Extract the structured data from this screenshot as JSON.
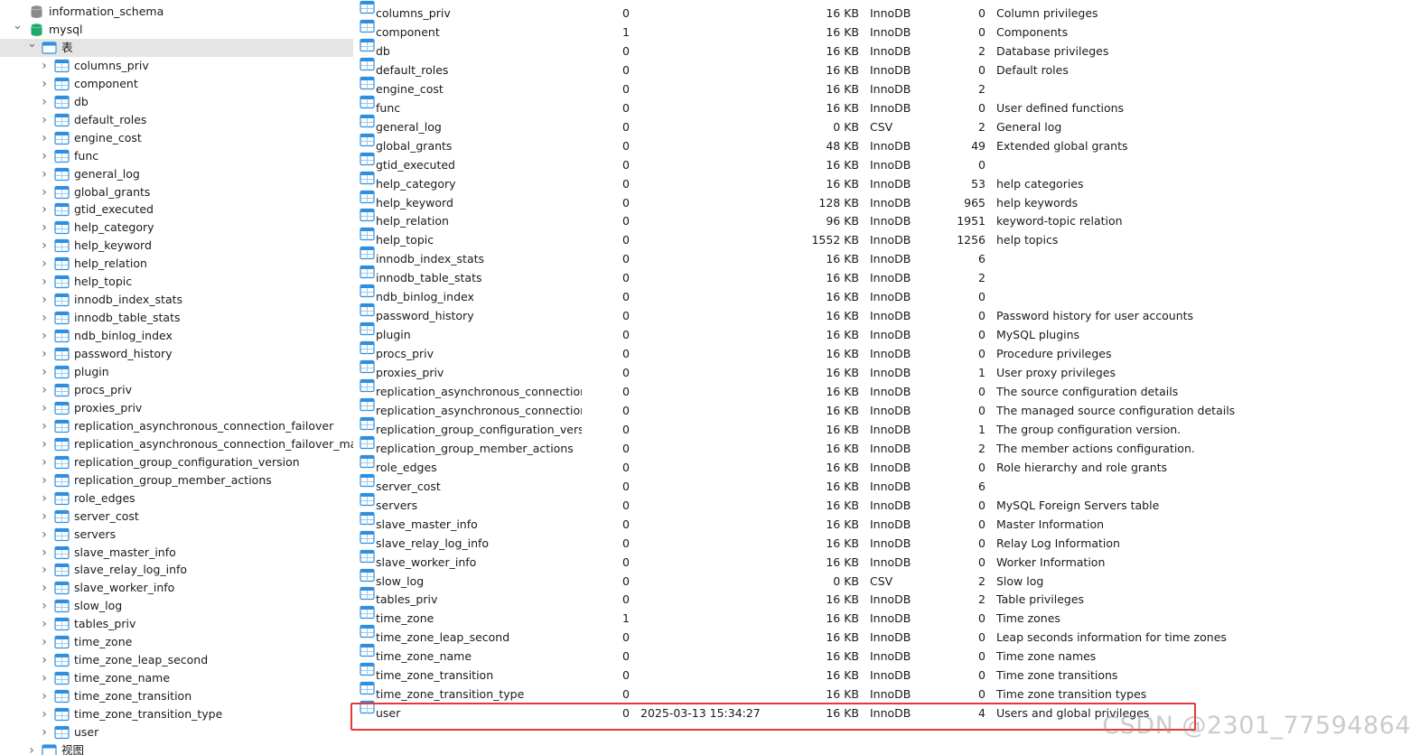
{
  "tree": {
    "databases": [
      {
        "label": "information_schema",
        "expanded": false,
        "icon": "database-icon-gray"
      },
      {
        "label": "mysql",
        "expanded": true,
        "icon": "database-icon-green"
      }
    ],
    "tables_folder": {
      "label": "表",
      "expanded": true
    },
    "tables": [
      "columns_priv",
      "component",
      "db",
      "default_roles",
      "engine_cost",
      "func",
      "general_log",
      "global_grants",
      "gtid_executed",
      "help_category",
      "help_keyword",
      "help_relation",
      "help_topic",
      "innodb_index_stats",
      "innodb_table_stats",
      "ndb_binlog_index",
      "password_history",
      "plugin",
      "procs_priv",
      "proxies_priv",
      "replication_asynchronous_connection_failover",
      "replication_asynchronous_connection_failover_managed",
      "replication_group_configuration_version",
      "replication_group_member_actions",
      "role_edges",
      "server_cost",
      "servers",
      "slave_master_info",
      "slave_relay_log_info",
      "slave_worker_info",
      "slow_log",
      "tables_priv",
      "time_zone",
      "time_zone_leap_second",
      "time_zone_name",
      "time_zone_transition",
      "time_zone_transition_type",
      "user"
    ],
    "views_folder": {
      "label": "视图",
      "expanded": false
    }
  },
  "list": {
    "rows": [
      {
        "name": "columns_priv",
        "rows": "0",
        "modified": "",
        "size": "16 KB",
        "engine": "InnoDB",
        "auto": "0",
        "comment": "Column privileges"
      },
      {
        "name": "component",
        "rows": "1",
        "modified": "",
        "size": "16 KB",
        "engine": "InnoDB",
        "auto": "0",
        "comment": "Components"
      },
      {
        "name": "db",
        "rows": "0",
        "modified": "",
        "size": "16 KB",
        "engine": "InnoDB",
        "auto": "2",
        "comment": "Database privileges"
      },
      {
        "name": "default_roles",
        "rows": "0",
        "modified": "",
        "size": "16 KB",
        "engine": "InnoDB",
        "auto": "0",
        "comment": "Default roles"
      },
      {
        "name": "engine_cost",
        "rows": "0",
        "modified": "",
        "size": "16 KB",
        "engine": "InnoDB",
        "auto": "2",
        "comment": ""
      },
      {
        "name": "func",
        "rows": "0",
        "modified": "",
        "size": "16 KB",
        "engine": "InnoDB",
        "auto": "0",
        "comment": "User defined functions"
      },
      {
        "name": "general_log",
        "rows": "0",
        "modified": "",
        "size": "0 KB",
        "engine": "CSV",
        "auto": "2",
        "comment": "General log"
      },
      {
        "name": "global_grants",
        "rows": "0",
        "modified": "",
        "size": "48 KB",
        "engine": "InnoDB",
        "auto": "49",
        "comment": "Extended global grants"
      },
      {
        "name": "gtid_executed",
        "rows": "0",
        "modified": "",
        "size": "16 KB",
        "engine": "InnoDB",
        "auto": "0",
        "comment": ""
      },
      {
        "name": "help_category",
        "rows": "0",
        "modified": "",
        "size": "16 KB",
        "engine": "InnoDB",
        "auto": "53",
        "comment": "help categories"
      },
      {
        "name": "help_keyword",
        "rows": "0",
        "modified": "",
        "size": "128 KB",
        "engine": "InnoDB",
        "auto": "965",
        "comment": "help keywords"
      },
      {
        "name": "help_relation",
        "rows": "0",
        "modified": "",
        "size": "96 KB",
        "engine": "InnoDB",
        "auto": "1951",
        "comment": "keyword-topic relation"
      },
      {
        "name": "help_topic",
        "rows": "0",
        "modified": "",
        "size": "1552 KB",
        "engine": "InnoDB",
        "auto": "1256",
        "comment": "help topics"
      },
      {
        "name": "innodb_index_stats",
        "rows": "0",
        "modified": "",
        "size": "16 KB",
        "engine": "InnoDB",
        "auto": "6",
        "comment": ""
      },
      {
        "name": "innodb_table_stats",
        "rows": "0",
        "modified": "",
        "size": "16 KB",
        "engine": "InnoDB",
        "auto": "2",
        "comment": ""
      },
      {
        "name": "ndb_binlog_index",
        "rows": "0",
        "modified": "",
        "size": "16 KB",
        "engine": "InnoDB",
        "auto": "0",
        "comment": ""
      },
      {
        "name": "password_history",
        "rows": "0",
        "modified": "",
        "size": "16 KB",
        "engine": "InnoDB",
        "auto": "0",
        "comment": "Password history for user accounts"
      },
      {
        "name": "plugin",
        "rows": "0",
        "modified": "",
        "size": "16 KB",
        "engine": "InnoDB",
        "auto": "0",
        "comment": "MySQL plugins"
      },
      {
        "name": "procs_priv",
        "rows": "0",
        "modified": "",
        "size": "16 KB",
        "engine": "InnoDB",
        "auto": "0",
        "comment": "Procedure privileges"
      },
      {
        "name": "proxies_priv",
        "rows": "0",
        "modified": "",
        "size": "16 KB",
        "engine": "InnoDB",
        "auto": "1",
        "comment": "User proxy privileges"
      },
      {
        "name": "replication_asynchronous_connection...",
        "rows": "0",
        "modified": "",
        "size": "16 KB",
        "engine": "InnoDB",
        "auto": "0",
        "comment": "The source configuration details"
      },
      {
        "name": "replication_asynchronous_connection...",
        "rows": "0",
        "modified": "",
        "size": "16 KB",
        "engine": "InnoDB",
        "auto": "0",
        "comment": "The managed source configuration details"
      },
      {
        "name": "replication_group_configuration_versi...",
        "rows": "0",
        "modified": "",
        "size": "16 KB",
        "engine": "InnoDB",
        "auto": "1",
        "comment": "The group configuration version."
      },
      {
        "name": "replication_group_member_actions",
        "rows": "0",
        "modified": "",
        "size": "16 KB",
        "engine": "InnoDB",
        "auto": "2",
        "comment": "The member actions configuration."
      },
      {
        "name": "role_edges",
        "rows": "0",
        "modified": "",
        "size": "16 KB",
        "engine": "InnoDB",
        "auto": "0",
        "comment": "Role hierarchy and role grants"
      },
      {
        "name": "server_cost",
        "rows": "0",
        "modified": "",
        "size": "16 KB",
        "engine": "InnoDB",
        "auto": "6",
        "comment": ""
      },
      {
        "name": "servers",
        "rows": "0",
        "modified": "",
        "size": "16 KB",
        "engine": "InnoDB",
        "auto": "0",
        "comment": "MySQL Foreign Servers table"
      },
      {
        "name": "slave_master_info",
        "rows": "0",
        "modified": "",
        "size": "16 KB",
        "engine": "InnoDB",
        "auto": "0",
        "comment": "Master Information"
      },
      {
        "name": "slave_relay_log_info",
        "rows": "0",
        "modified": "",
        "size": "16 KB",
        "engine": "InnoDB",
        "auto": "0",
        "comment": "Relay Log Information"
      },
      {
        "name": "slave_worker_info",
        "rows": "0",
        "modified": "",
        "size": "16 KB",
        "engine": "InnoDB",
        "auto": "0",
        "comment": "Worker Information"
      },
      {
        "name": "slow_log",
        "rows": "0",
        "modified": "",
        "size": "0 KB",
        "engine": "CSV",
        "auto": "2",
        "comment": "Slow log"
      },
      {
        "name": "tables_priv",
        "rows": "0",
        "modified": "",
        "size": "16 KB",
        "engine": "InnoDB",
        "auto": "2",
        "comment": "Table privileges"
      },
      {
        "name": "time_zone",
        "rows": "1",
        "modified": "",
        "size": "16 KB",
        "engine": "InnoDB",
        "auto": "0",
        "comment": "Time zones"
      },
      {
        "name": "time_zone_leap_second",
        "rows": "0",
        "modified": "",
        "size": "16 KB",
        "engine": "InnoDB",
        "auto": "0",
        "comment": "Leap seconds information for time zones"
      },
      {
        "name": "time_zone_name",
        "rows": "0",
        "modified": "",
        "size": "16 KB",
        "engine": "InnoDB",
        "auto": "0",
        "comment": "Time zone names"
      },
      {
        "name": "time_zone_transition",
        "rows": "0",
        "modified": "",
        "size": "16 KB",
        "engine": "InnoDB",
        "auto": "0",
        "comment": "Time zone transitions"
      },
      {
        "name": "time_zone_transition_type",
        "rows": "0",
        "modified": "",
        "size": "16 KB",
        "engine": "InnoDB",
        "auto": "0",
        "comment": "Time zone transition types"
      },
      {
        "name": "user",
        "rows": "0",
        "modified": "2025-03-13 15:34:27",
        "size": "16 KB",
        "engine": "InnoDB",
        "auto": "4",
        "comment": "Users and global privileges"
      }
    ],
    "highlighted_row": "user"
  },
  "colors": {
    "highlight_border": "#e53935",
    "table_icon": "#2f8fde",
    "db_green": "#1faa6b",
    "db_gray": "#8a8a8a",
    "selected_bg": "#e5e5e5"
  },
  "watermark": "CSDN @2301_77594864"
}
